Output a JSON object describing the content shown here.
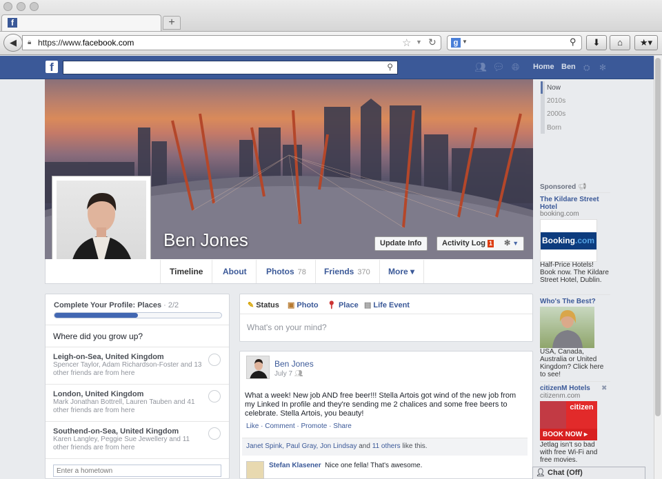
{
  "browser": {
    "tab_favicon": "f",
    "newtab_label": "+",
    "back_icon": "◀",
    "url_scheme": "https://www.",
    "url_host": "facebook.com",
    "search_engine_icon": "g",
    "toolbar_icons": [
      "download-icon",
      "home-icon",
      "bookmarks-icon"
    ]
  },
  "fb_header": {
    "logo": "f",
    "search_placeholder": "",
    "home_label": "Home",
    "user_label": "Ben"
  },
  "profile": {
    "name": "Ben Jones",
    "update_info_label": "Update Info",
    "activity_log_label": "Activity Log",
    "activity_count": "1",
    "tabs": [
      {
        "label": "Timeline",
        "count": ""
      },
      {
        "label": "About",
        "count": ""
      },
      {
        "label": "Photos",
        "count": "78"
      },
      {
        "label": "Friends",
        "count": "370"
      },
      {
        "label": "More ▾",
        "count": ""
      }
    ]
  },
  "profile_completion": {
    "title": "Complete Your Profile: Places",
    "progress_text": " · 2/2",
    "progress_fraction": 0.5,
    "question": "Where did you grow up?",
    "places": [
      {
        "name": "Leigh-on-Sea, United Kingdom",
        "friends": "Spencer Taylor, Adam Richardson-Foster and 13 other friends are from here"
      },
      {
        "name": "London, United Kingdom",
        "friends": "Mark Jonathan Bottrell, Lauren Tauben and 41 other friends are from here"
      },
      {
        "name": "Southend-on-Sea, United Kingdom",
        "friends": "Karen Langley, Peggie Sue Jewellery and 11 other friends are from here"
      }
    ],
    "hometown_placeholder": "Enter a hometown"
  },
  "composer": {
    "tabs": [
      "Status",
      "Photo",
      "Place",
      "Life Event"
    ],
    "placeholder": "What's on your mind?"
  },
  "post": {
    "author": "Ben Jones",
    "date": "July 7",
    "text": "What a week! New job AND free beer!!! Stella Artois got wind of the new job from my Linked In profile and they're sending me 2 chalices and some free beers to celebrate. Stella Artois, you beauty!",
    "actions": [
      "Like",
      "Comment",
      "Promote",
      "Share"
    ],
    "likes_names": "Janet Spink, Paul Gray, Jon Lindsay",
    "likes_and": " and ",
    "likes_others": "11 others",
    "likes_suffix": " like this.",
    "comment_author": "Stefan Klasener",
    "comment_text": "Nice one fella! That's awesome."
  },
  "timeline_nav": [
    "Now",
    "2010s",
    "2000s",
    "Born"
  ],
  "ads": {
    "sponsored_label": "Sponsored",
    "items": [
      {
        "title": "The Kildare Street Hotel",
        "domain": "booking.com",
        "body": "Half-Price Hotels! Book now. The Kildare Street Hotel, Dublin."
      },
      {
        "title": "Who's The Best?",
        "domain": "",
        "body": "USA, Canada, Australia or United Kingdom? Click here to see!"
      },
      {
        "title": "citizenM Hotels",
        "domain": "citizenm.com",
        "body": "Jetlag isn't so bad with free Wi-Fi and free movies."
      }
    ],
    "booking_logo_main": "Booking",
    "booking_logo_tld": ".com",
    "citizen_logo": "citizen",
    "book_now_label": "BOOK NOW ▸"
  },
  "chat": {
    "label": "Chat (Off)"
  },
  "colors": {
    "fb_blue": "#3b5998",
    "link": "#3b5998",
    "badge": "#dd3c10"
  }
}
